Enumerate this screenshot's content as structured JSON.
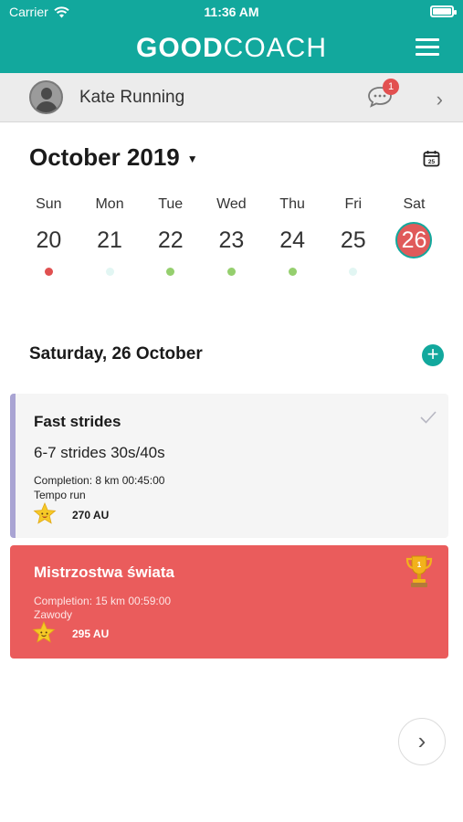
{
  "status": {
    "carrier": "Carrier",
    "time": "11:36 AM"
  },
  "header": {
    "brand_bold": "GOOD",
    "brand_light": "COACH"
  },
  "user": {
    "name": "Kate Running",
    "messages_badge": "1"
  },
  "calendar": {
    "month_label": "October 2019",
    "calendar_icon_day": "25",
    "days": [
      {
        "name": "Sun",
        "date": "20",
        "dot": "#e05050"
      },
      {
        "name": "Mon",
        "date": "21",
        "dot": "#e2f6f3"
      },
      {
        "name": "Tue",
        "date": "22",
        "dot": "#95cf6e"
      },
      {
        "name": "Wed",
        "date": "23",
        "dot": "#95cf6e"
      },
      {
        "name": "Thu",
        "date": "24",
        "dot": "#95cf6e"
      },
      {
        "name": "Fri",
        "date": "25",
        "dot": "#e2f6f3"
      },
      {
        "name": "Sat",
        "date": "26",
        "dot": "",
        "selected": true
      }
    ]
  },
  "selected_date": "Saturday, 26 October",
  "workouts": [
    {
      "title": "Fast strides",
      "description": "6-7 strides 30s/40s",
      "completion": "Completion: 8 km 00:45:00",
      "type": "Tempo run",
      "load": "270 AU",
      "accent": "#a9a4d3",
      "completed": true
    },
    {
      "title": "Mistrzostwa świata",
      "completion": "Completion: 15 km 00:59:00",
      "type": "Zawody",
      "load": "295 AU",
      "background": "#ea5c5c",
      "icon": "trophy-icon"
    }
  ],
  "colors": {
    "brand": "#12a89d",
    "selected_day": "#e05a5a",
    "competition": "#ea5c5c"
  }
}
